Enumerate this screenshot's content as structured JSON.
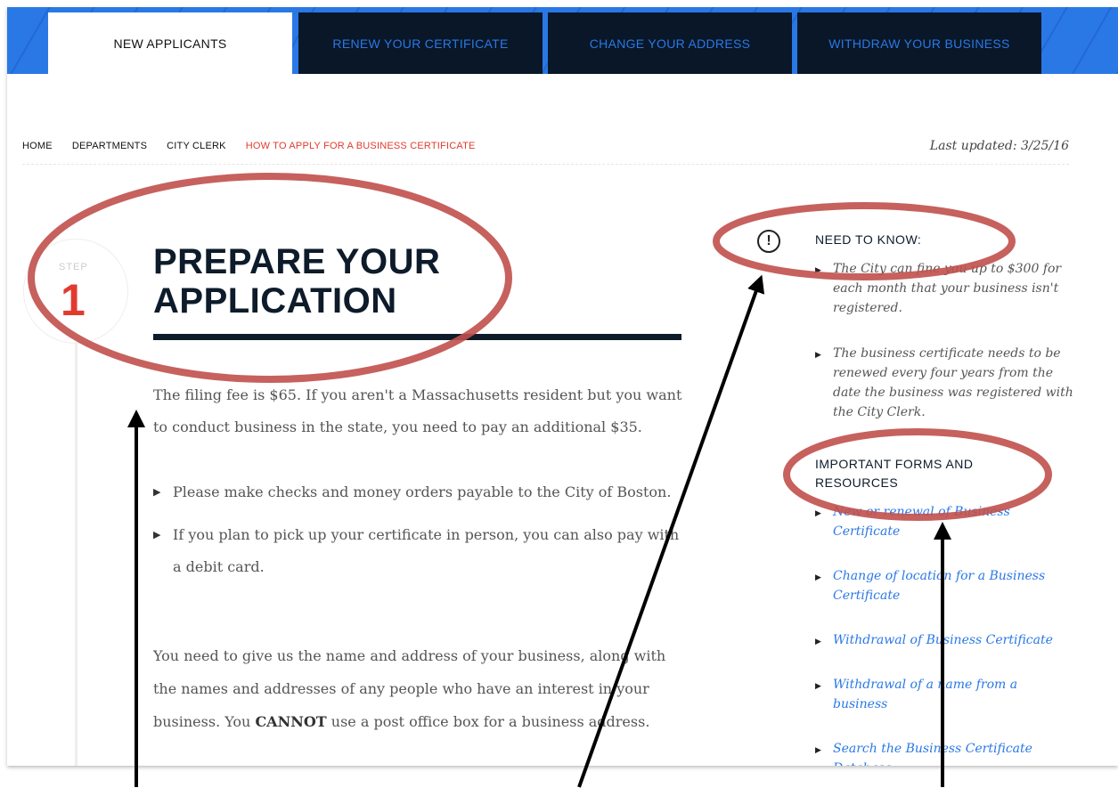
{
  "tabs": [
    {
      "label": "NEW APPLICANTS",
      "active": true
    },
    {
      "label": "RENEW YOUR CERTIFICATE",
      "active": false
    },
    {
      "label": "CHANGE YOUR ADDRESS",
      "active": false
    },
    {
      "label": "WITHDRAW YOUR BUSINESS",
      "active": false
    }
  ],
  "breadcrumb": [
    "HOME",
    "DEPARTMENTS",
    "CITY CLERK",
    "HOW TO APPLY FOR A BUSINESS CERTIFICATE"
  ],
  "last_updated": "Last updated: 3/25/16",
  "step": {
    "label": "STEP",
    "number": "1"
  },
  "title_line1": "PREPARE YOUR",
  "title_line2": "APPLICATION",
  "intro": "The filing fee is $65. If you aren't a Massachusetts resident but you want to conduct business in the state, you need to pay an additional $35.",
  "bullets": [
    "Please make checks and money orders payable to the City of Boston.",
    "If you plan to pick up your certificate in person, you can also pay with a debit card."
  ],
  "para2_before": "You need to give us the name and address of your business, along with the names and addresses of any people who have an interest in your business. You ",
  "para2_bold": "CANNOT",
  "para2_after": " use a post office box for a business address.",
  "need_to_know": {
    "icon": "exclamation-circle-icon",
    "heading": "NEED TO KNOW:",
    "items": [
      "The City can fine you up to $300 for each month that your business isn't registered.",
      "The business certificate needs to be renewed every four years from the date the business was registered with the City Clerk."
    ]
  },
  "forms": {
    "heading": "IMPORTANT FORMS AND RESOURCES",
    "links": [
      "New or renewal of Business Certificate",
      "Change of location for a Business Certificate",
      "Withdrawal of Business Certificate",
      "Withdrawal of a name from a business",
      "Search the Business Certificate Database"
    ]
  },
  "colors": {
    "accent_red": "#e23b2e",
    "navy": "#0d1b2a",
    "link_blue": "#2a78e6",
    "annotation_red": "#c0504d"
  }
}
